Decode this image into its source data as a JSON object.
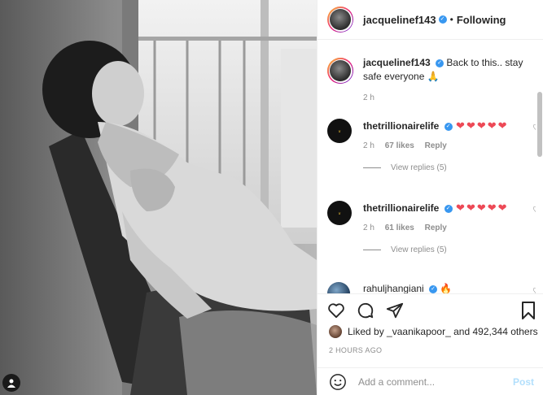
{
  "header": {
    "username": "jacquelinef143",
    "separator": "•",
    "follow_state": "Following"
  },
  "caption": {
    "username": "jacquelinef143",
    "text": "Back to this.. stay safe everyone 🙏",
    "time": "2 h"
  },
  "comments": [
    {
      "username": "thetrillionairelife",
      "text": "❤❤❤❤❤",
      "time": "2 h",
      "likes": "67 likes",
      "reply": "Reply",
      "view_replies": "View replies (5)"
    },
    {
      "username": "thetrillionairelife",
      "text": "❤❤❤❤❤",
      "time": "2 h",
      "likes": "61 likes",
      "reply": "Reply",
      "view_replies": "View replies (5)"
    },
    {
      "username": "rahuljhangiani",
      "text": "🔥"
    }
  ],
  "likes": {
    "prefix": "Liked by",
    "first_user": "_vaanikapoor_",
    "and": "and",
    "others": "492,344 others"
  },
  "timestamp": "2 HOURS AGO",
  "comment_box": {
    "placeholder": "Add a comment...",
    "post_label": "Post"
  },
  "icons": {
    "like": "heart-outline-icon",
    "comment": "comment-bubble-icon",
    "share": "paper-plane-icon",
    "save": "bookmark-icon",
    "emoji": "emoji-smiley-icon",
    "tagged": "user-tag-icon",
    "verified": "verified-badge-icon"
  },
  "colors": {
    "verified": "#3897f0",
    "heart": "#ed4956",
    "post_disabled": "#b2dffc",
    "meta": "#8e8e8e"
  }
}
